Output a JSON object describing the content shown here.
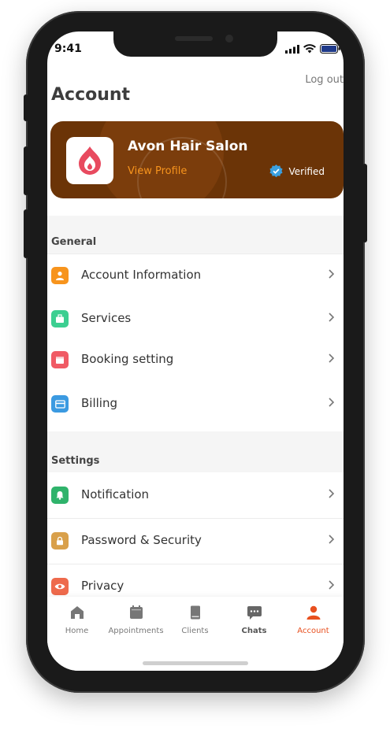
{
  "status_bar": {
    "time": "9:41"
  },
  "header": {
    "logout": "Log out",
    "title": "Account"
  },
  "profile": {
    "name": "Avon Hair Salon",
    "view_profile": "View Profile",
    "verified": "Verified",
    "colors": {
      "card": "#6b3407",
      "accent": "#f7941d",
      "logo": "#e84a5f",
      "verified_badge": "#3aa0e0"
    }
  },
  "sections": {
    "general": {
      "title": "General",
      "items": [
        {
          "label": "Account Information",
          "icon": "user-icon",
          "color": "#f7941d"
        },
        {
          "label": "Services",
          "icon": "briefcase-icon",
          "color": "#3ccf91"
        },
        {
          "label": "Booking setting",
          "icon": "calendar-icon",
          "color": "#f05a64"
        },
        {
          "label": "Billing",
          "icon": "credit-card-icon",
          "color": "#3b9ae1"
        }
      ]
    },
    "settings": {
      "title": "Settings",
      "items": [
        {
          "label": "Notification",
          "icon": "bell-icon",
          "color": "#2fb36b"
        },
        {
          "label": "Password & Security",
          "icon": "lock-icon",
          "color": "#d9a04a"
        },
        {
          "label": "Privacy",
          "icon": "eye-icon",
          "color": "#ee6a4c"
        }
      ]
    }
  },
  "tabbar": {
    "items": [
      {
        "label": "Home",
        "icon": "home-icon"
      },
      {
        "label": "Appointments",
        "icon": "calendar-icon"
      },
      {
        "label": "Clients",
        "icon": "book-icon"
      },
      {
        "label": "Chats",
        "icon": "chat-icon"
      },
      {
        "label": "Account",
        "icon": "person-icon"
      }
    ],
    "active": "Account",
    "active_color": "#e8501f"
  }
}
